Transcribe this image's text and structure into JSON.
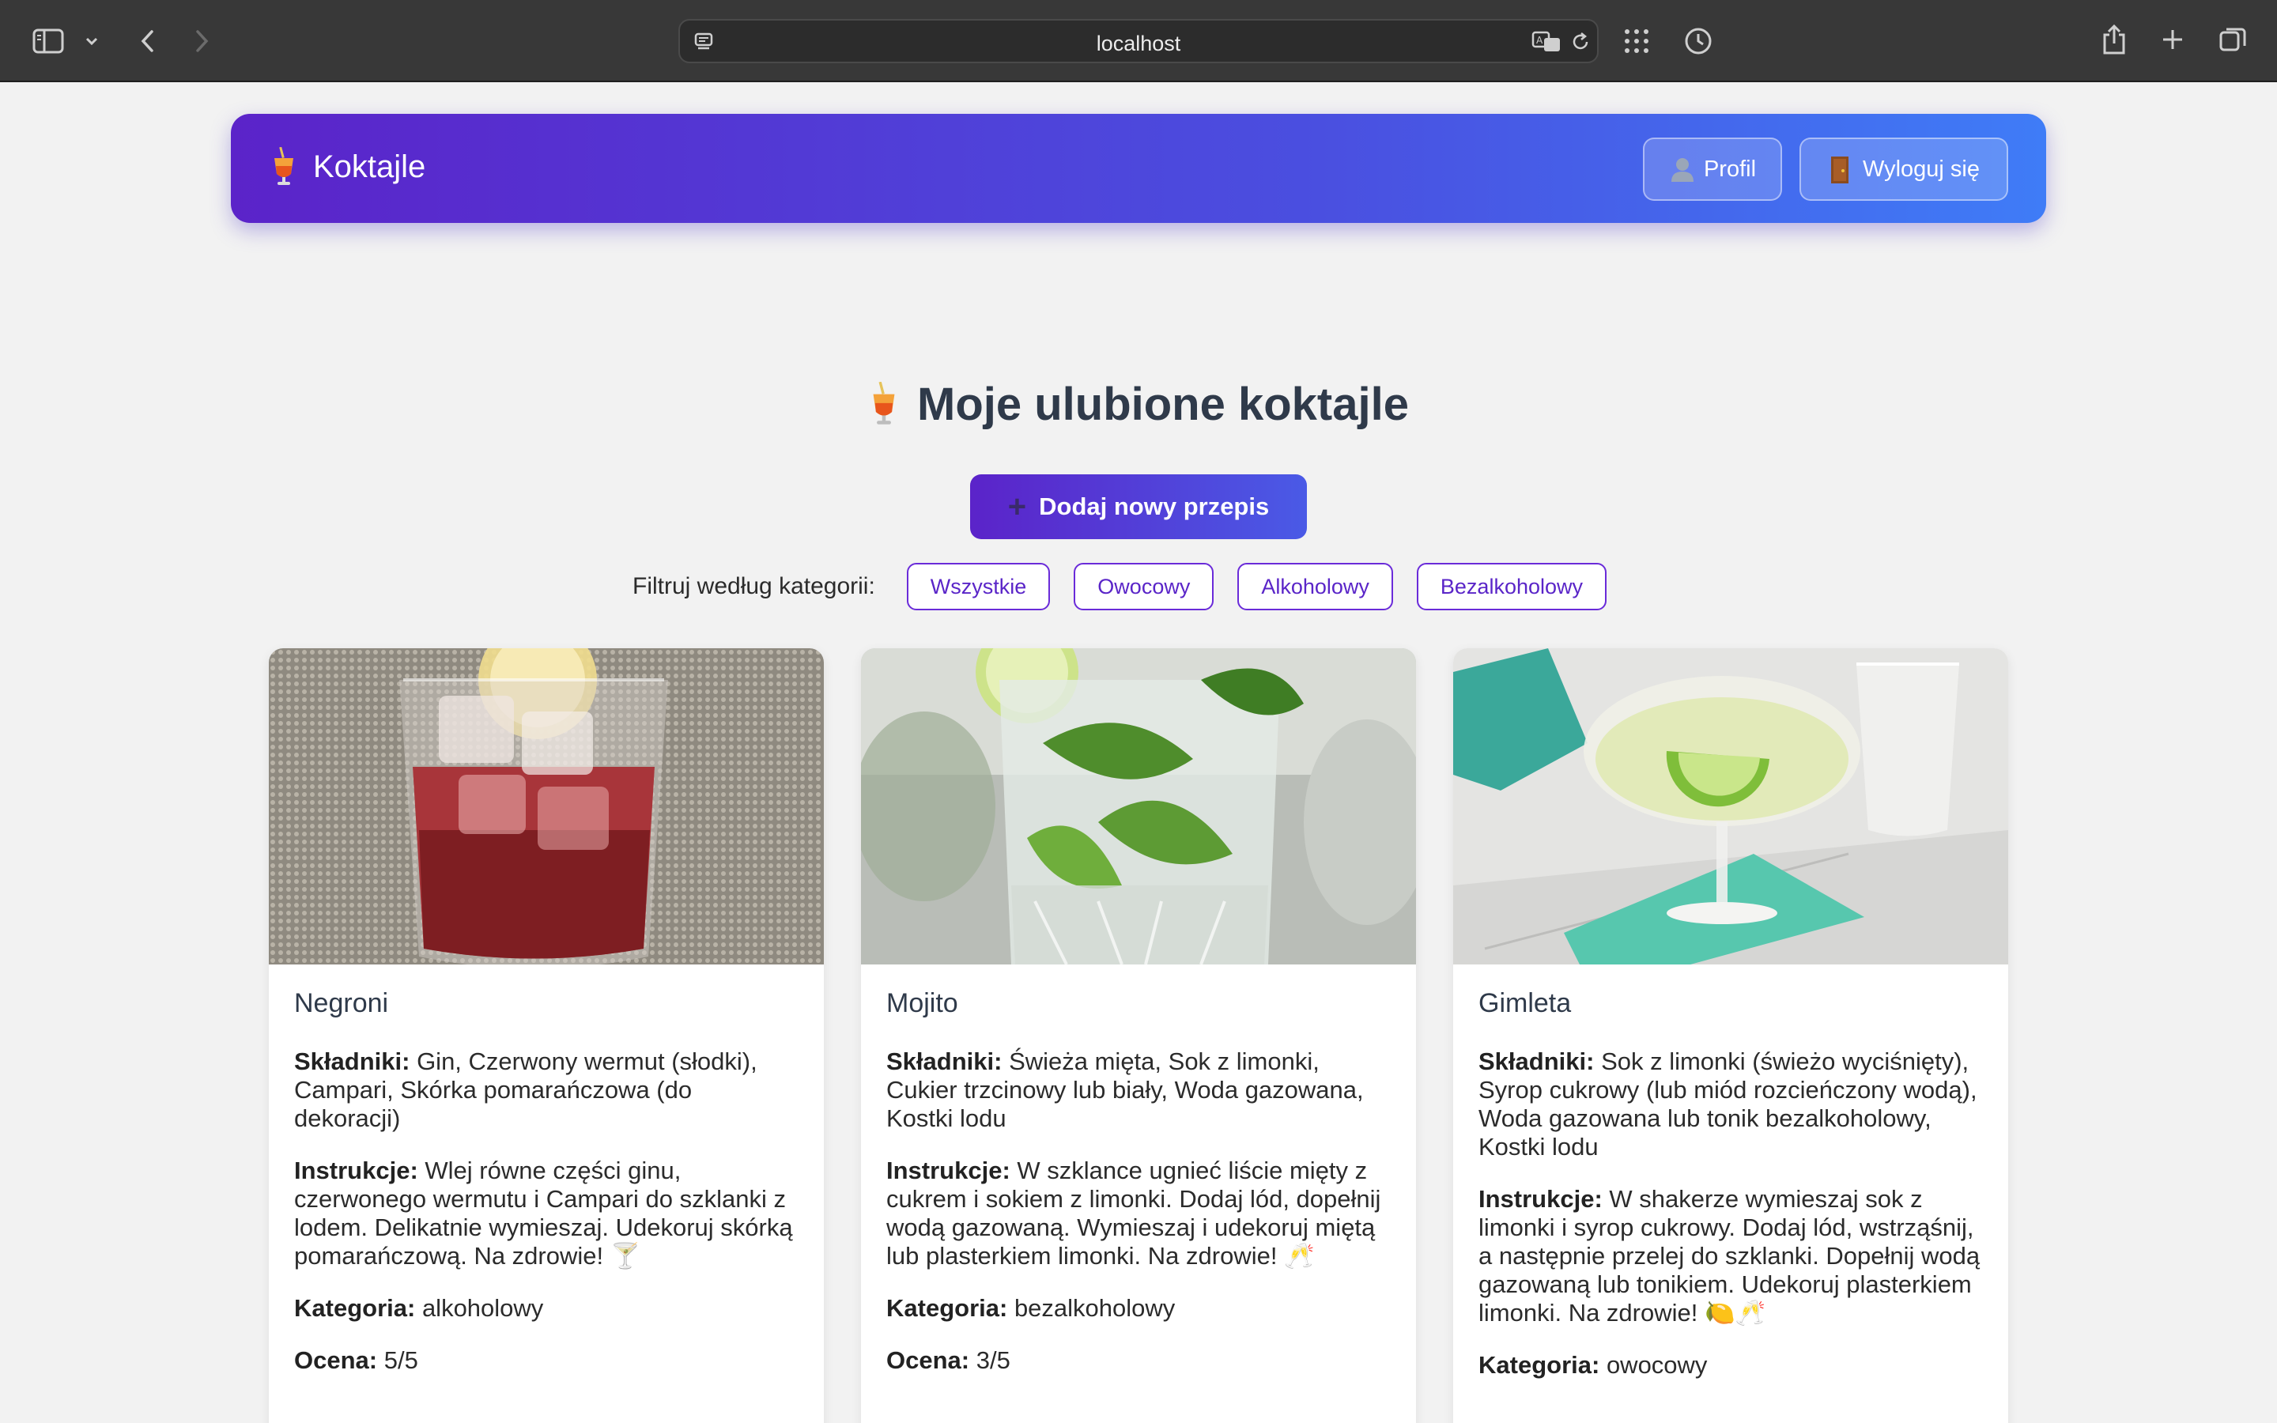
{
  "browser": {
    "url": "localhost"
  },
  "header": {
    "brand": "Koktajle",
    "profile_label": "Profil",
    "logout_label": "Wyloguj się"
  },
  "main": {
    "title": "Moje ulubione koktajle",
    "add_button": "Dodaj nowy przepis",
    "filter_label": "Filtruj według kategorii:",
    "filters": [
      "Wszystkie",
      "Owocowy",
      "Alkoholowy",
      "Bezalkoholowy"
    ]
  },
  "labels": {
    "ingredients": "Składniki:",
    "instructions": "Instrukcje:",
    "category": "Kategoria:",
    "rating": "Ocena:"
  },
  "cards": [
    {
      "name": "Negroni",
      "ingredients": "Gin, Czerwony wermut (słodki), Campari, Skórka pomarańczowa (do dekoracji)",
      "instructions": "Wlej równe części ginu, czerwonego wermutu i Campari do szklanki z lodem. Delikatnie wymieszaj. Udekoruj skórką pomarańczową. Na zdrowie! 🍸",
      "category": "alkoholowy",
      "rating": "5/5"
    },
    {
      "name": "Mojito",
      "ingredients": "Świeża mięta, Sok z limonki, Cukier trzcinowy lub biały, Woda gazowana, Kostki lodu",
      "instructions": "W szklance ugnieć liście mięty z cukrem i sokiem z limonki. Dodaj lód, dopełnij wodą gazowaną. Wymieszaj i udekoruj miętą lub plasterkiem limonki. Na zdrowie! 🥂",
      "category": "bezalkoholowy",
      "rating": "3/5"
    },
    {
      "name": "Gimleta",
      "ingredients": "Sok z limonki (świeżo wyciśnięty), Syrop cukrowy (lub miód rozcieńczony wodą), Woda gazowana lub tonik bezalkoholowy, Kostki lodu",
      "instructions": "W shakerze wymieszaj sok z limonki i syrop cukrowy. Dodaj lód, wstrząśnij, a następnie przelej do szklanki. Dopełnij wodą gazowaną lub tonikiem. Udekoruj plasterkiem limonki. Na zdrowie! 🍋🥂",
      "category": "owocowy",
      "rating": ""
    }
  ],
  "colors": {
    "accent": "#5b23c9",
    "accent_end": "#3f7cf7",
    "chip_border": "#6a2bd9",
    "page_bg": "#f2f2f2",
    "toolbar_bg": "#383838"
  },
  "icons": [
    "sidebar-icon",
    "chevron-down-icon",
    "back-icon",
    "forward-icon",
    "reader-icon",
    "translate-icon",
    "reload-icon",
    "grid-icon",
    "history-icon",
    "share-icon",
    "new-tab-icon",
    "tabs-overview-icon",
    "cocktail-icon",
    "user-icon",
    "door-icon",
    "plus-icon"
  ]
}
